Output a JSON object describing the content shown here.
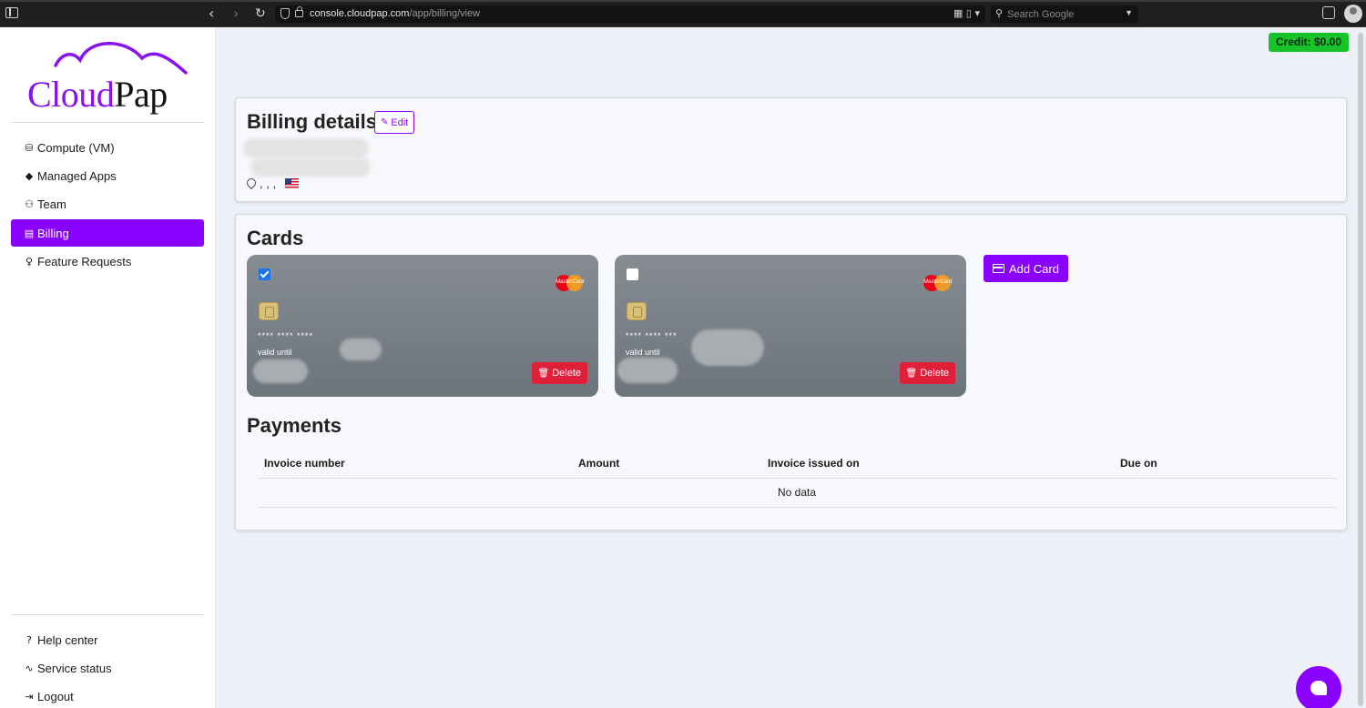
{
  "browser": {
    "url_domain": "console.cloudpap.com",
    "url_path": "/app/billing/view",
    "search_placeholder": "Search Google"
  },
  "logo": {
    "part1": "Cloud",
    "part2": "Pap"
  },
  "sidebar": {
    "items": [
      {
        "label": "Compute (VM)",
        "icon": "database-icon"
      },
      {
        "label": "Managed Apps",
        "icon": "layers-icon"
      },
      {
        "label": "Team",
        "icon": "people-icon"
      },
      {
        "label": "Billing",
        "icon": "receipt-icon",
        "active": true
      },
      {
        "label": "Feature Requests",
        "icon": "lightbulb-icon"
      }
    ],
    "bottom_items": [
      {
        "label": "Help center",
        "icon": "question-icon"
      },
      {
        "label": "Service status",
        "icon": "activity-icon"
      },
      {
        "label": "Logout",
        "icon": "logout-icon"
      }
    ]
  },
  "credit": {
    "label": "Credit: $0.00"
  },
  "billing_details": {
    "title": "Billing details",
    "edit_label": "Edit",
    "address": ", , ,"
  },
  "cards": {
    "title": "Cards",
    "add_label": "Add Card",
    "brand": "MasterCard",
    "items": [
      {
        "selected": true,
        "number": "**** **** ****",
        "valid_label": "valid until",
        "delete_label": "Delete"
      },
      {
        "selected": false,
        "number": "**** **** ***",
        "valid_label": "valid until",
        "delete_label": "Delete"
      }
    ]
  },
  "payments": {
    "title": "Payments",
    "columns": [
      "Invoice number",
      "Amount",
      "Invoice issued on",
      "Due on"
    ],
    "empty_text": "No data"
  },
  "colors": {
    "accent": "#8a00ff",
    "credit": "#16c42a",
    "danger": "#e0203a"
  }
}
